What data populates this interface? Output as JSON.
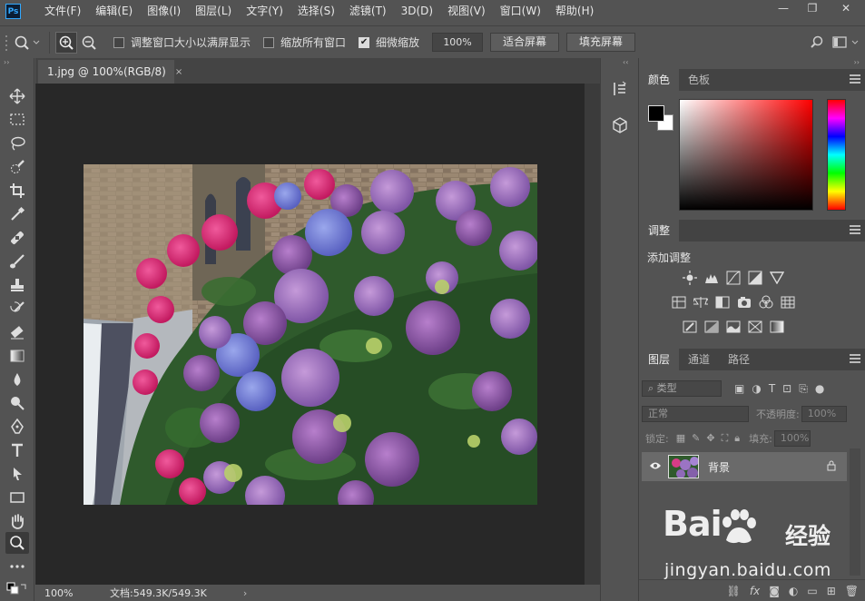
{
  "app": {
    "logo_text": "Ps"
  },
  "menu": [
    "文件(F)",
    "编辑(E)",
    "图像(I)",
    "图层(L)",
    "文字(Y)",
    "选择(S)",
    "滤镜(T)",
    "3D(D)",
    "视图(V)",
    "窗口(W)",
    "帮助(H)"
  ],
  "window_controls": {
    "minimize": "—",
    "restore": "❐",
    "close": "✕"
  },
  "options": {
    "resize_windows_label": "调整窗口大小以满屏显示",
    "resize_windows_checked": false,
    "zoom_all_windows_label": "缩放所有窗口",
    "zoom_all_windows_checked": false,
    "scrubby_zoom_label": "细微缩放",
    "scrubby_zoom_checked": true,
    "zoom_value": "100%",
    "fit_screen_label": "适合屏幕",
    "fill_screen_label": "填充屏幕"
  },
  "document": {
    "tab_title": "1.jpg @ 100%(RGB/8)",
    "tab_close": "×",
    "status_zoom": "100%",
    "status_info": "文档:549.3K/549.3K",
    "status_arrow": "›"
  },
  "color_panel": {
    "tabs": [
      "颜色",
      "色板"
    ],
    "foreground": "#000000",
    "background": "#ffffff"
  },
  "adjustments_panel": {
    "tab": "调整",
    "title": "添加调整"
  },
  "layers_panel": {
    "tabs": [
      "图层",
      "通道",
      "路径"
    ],
    "filter_kind": "类型",
    "blend_mode": "正常",
    "opacity_label": "不透明度:",
    "opacity_value": "100%",
    "lock_label": "锁定:",
    "fill_label": "填充:",
    "fill_value": "100%",
    "layer_name": "背景"
  },
  "watermark": {
    "brand": "Bai",
    "brand_tail": "经验",
    "url": "jingyan.baidu.com"
  },
  "colors": {
    "ui_bg": "#535353",
    "canvas_bg": "#282828",
    "accent": "#31a8ff"
  }
}
